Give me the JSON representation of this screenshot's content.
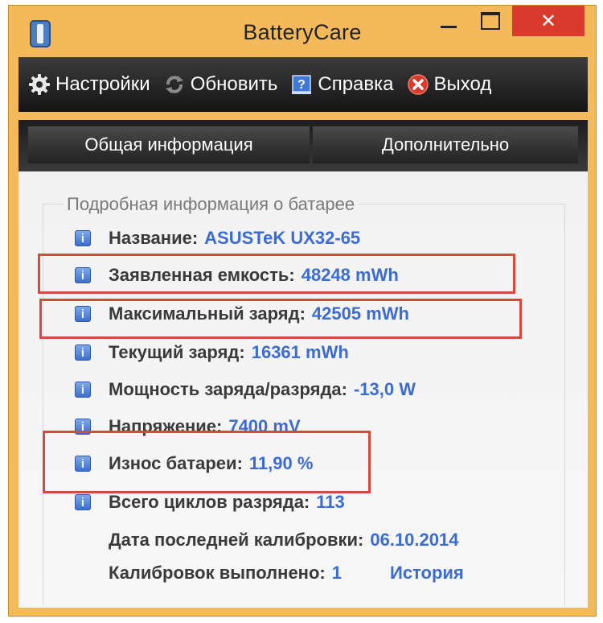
{
  "window": {
    "title": "BatteryCare",
    "close_glyph": "✕"
  },
  "toolbar": {
    "items": [
      {
        "label": "Настройки",
        "icon": "gear-icon"
      },
      {
        "label": "Обновить",
        "icon": "refresh-icon"
      },
      {
        "label": "Справка",
        "icon": "help-icon"
      },
      {
        "label": "Выход",
        "icon": "exit-icon"
      }
    ]
  },
  "tabs": [
    {
      "label": "Общая информация"
    },
    {
      "label": "Дополнительно"
    }
  ],
  "details": {
    "group_title": "Подробная информация о батарее",
    "info_glyph": "i",
    "rows": [
      {
        "label": "Название:",
        "value": "ASUSTeK UX32-65"
      },
      {
        "label": "Заявленная емкость:",
        "value": "48248 mWh"
      },
      {
        "label": "Максимальный заряд:",
        "value": "42505 mWh"
      },
      {
        "label": "Текущий заряд:",
        "value": "16361 mWh"
      },
      {
        "label": "Мощность заряда/разряда:",
        "value": "-13,0 W"
      },
      {
        "label": "Напряжение:",
        "value": "7400 mV"
      },
      {
        "label": "Износ батареи:",
        "value": "11,90 %"
      },
      {
        "label": "Всего циклов разряда:",
        "value": "113"
      },
      {
        "label": "Дата последней калибровки:",
        "value": "06.10.2014"
      },
      {
        "label": "Калибровок выполнено:",
        "value": "1",
        "link": "История"
      }
    ]
  },
  "colors": {
    "frame": "#f3b95a",
    "highlight": "#d34a3e",
    "value_text": "#3c6cd0",
    "close_button": "#d93a2e"
  }
}
